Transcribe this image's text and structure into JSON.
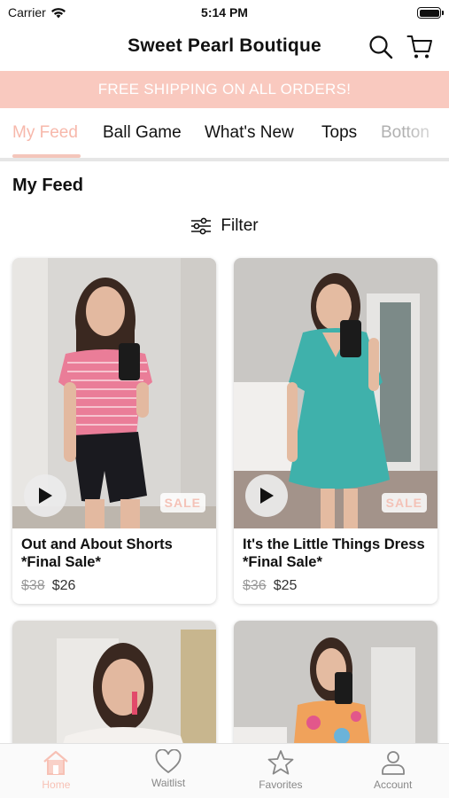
{
  "status": {
    "carrier": "Carrier",
    "time": "5:14 PM"
  },
  "nav": {
    "title": "Sweet Pearl Boutique"
  },
  "promo": {
    "text": "FREE SHIPPING ON ALL ORDERS!"
  },
  "tabs": [
    {
      "label": "My Feed"
    },
    {
      "label": "Ball Game"
    },
    {
      "label": "What's New"
    },
    {
      "label": "Tops"
    },
    {
      "label": "Botton"
    }
  ],
  "feed": {
    "title": "My Feed",
    "filter_label": "Filter"
  },
  "products": [
    {
      "name": "Out and About Shorts *Final Sale*",
      "old_price": "$38",
      "price": "$26",
      "badge": "SALE"
    },
    {
      "name": "It's the Little Things Dress *Final Sale*",
      "old_price": "$36",
      "price": "$25",
      "badge": "SALE"
    }
  ],
  "bottom_tabs": [
    {
      "label": "Home",
      "icon": "home-icon"
    },
    {
      "label": "Waitlist",
      "icon": "heart-icon"
    },
    {
      "label": "Favorites",
      "icon": "star-icon"
    },
    {
      "label": "Account",
      "icon": "person-icon"
    }
  ],
  "colors": {
    "accent": "#f7b8ab",
    "banner": "#f9c9bf"
  }
}
